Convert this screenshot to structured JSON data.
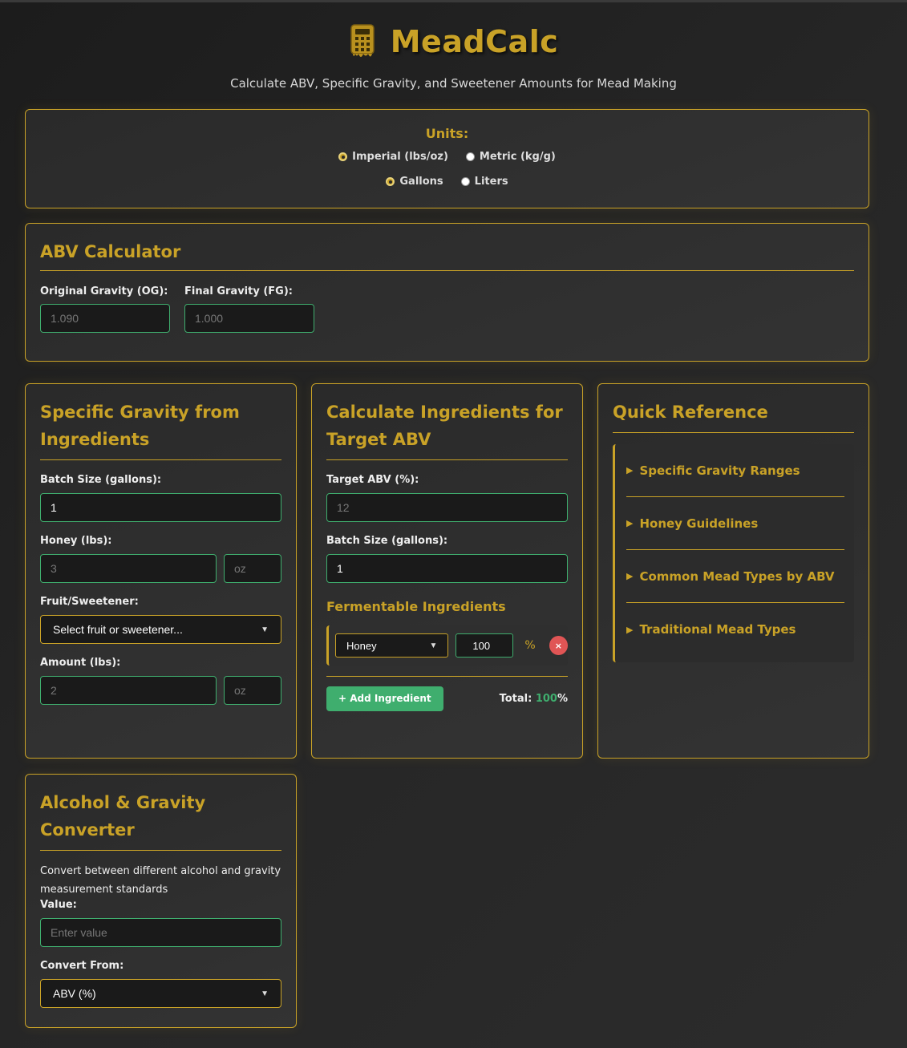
{
  "header": {
    "title": "MeadCalc",
    "subtitle": "Calculate ABV, Specific Gravity, and Sweetener Amounts for Mead Making",
    "logo_icon": "calculator-icon"
  },
  "units": {
    "title": "Units:",
    "weight_options": [
      {
        "label": "Imperial (lbs/oz)",
        "checked": true
      },
      {
        "label": "Metric (kg/g)",
        "checked": false
      }
    ],
    "volume_options": [
      {
        "label": "Gallons",
        "checked": true
      },
      {
        "label": "Liters",
        "checked": false
      }
    ]
  },
  "abv": {
    "title": "ABV Calculator",
    "og_label": "Original Gravity (OG):",
    "og_placeholder": "1.090",
    "fg_label": "Final Gravity (FG):",
    "fg_placeholder": "1.000"
  },
  "sg": {
    "title": "Specific Gravity from Ingredients",
    "batch_label": "Batch Size (gallons):",
    "batch_value": "1",
    "honey_label": "Honey (lbs):",
    "honey_placeholder": "3",
    "honey_oz_placeholder": "oz",
    "fruit_label": "Fruit/Sweetener:",
    "fruit_selected": "Select fruit or sweetener...",
    "amount_label": "Amount (lbs):",
    "amount_placeholder": "2",
    "amount_oz_placeholder": "oz"
  },
  "ingredients": {
    "title": "Calculate Ingredients for Target ABV",
    "target_label": "Target ABV (%):",
    "target_placeholder": "12",
    "batch_label": "Batch Size (gallons):",
    "batch_value": "1",
    "fermentables_title": "Fermentable Ingredients",
    "rows": [
      {
        "ingredient": "Honey",
        "percent": "100",
        "pct_sign": "%",
        "remove": "×"
      }
    ],
    "add_button": "+ Add Ingredient",
    "total_label": "Total:",
    "total_value": "100",
    "total_suffix": "%"
  },
  "quick_reference": {
    "title": "Quick Reference",
    "items": [
      "Specific Gravity Ranges",
      "Honey Guidelines",
      "Common Mead Types by ABV",
      "Traditional Mead Types"
    ]
  },
  "converter": {
    "title": "Alcohol & Gravity Converter",
    "description": "Convert between different alcohol and gravity measurement standards",
    "value_label": "Value:",
    "value_placeholder": "Enter value",
    "from_label": "Convert From:",
    "from_selected": "ABV (%)"
  },
  "colors": {
    "accent": "#c9a227",
    "input_border": "#3fae6e",
    "remove": "#e05555",
    "background": "#262626"
  }
}
